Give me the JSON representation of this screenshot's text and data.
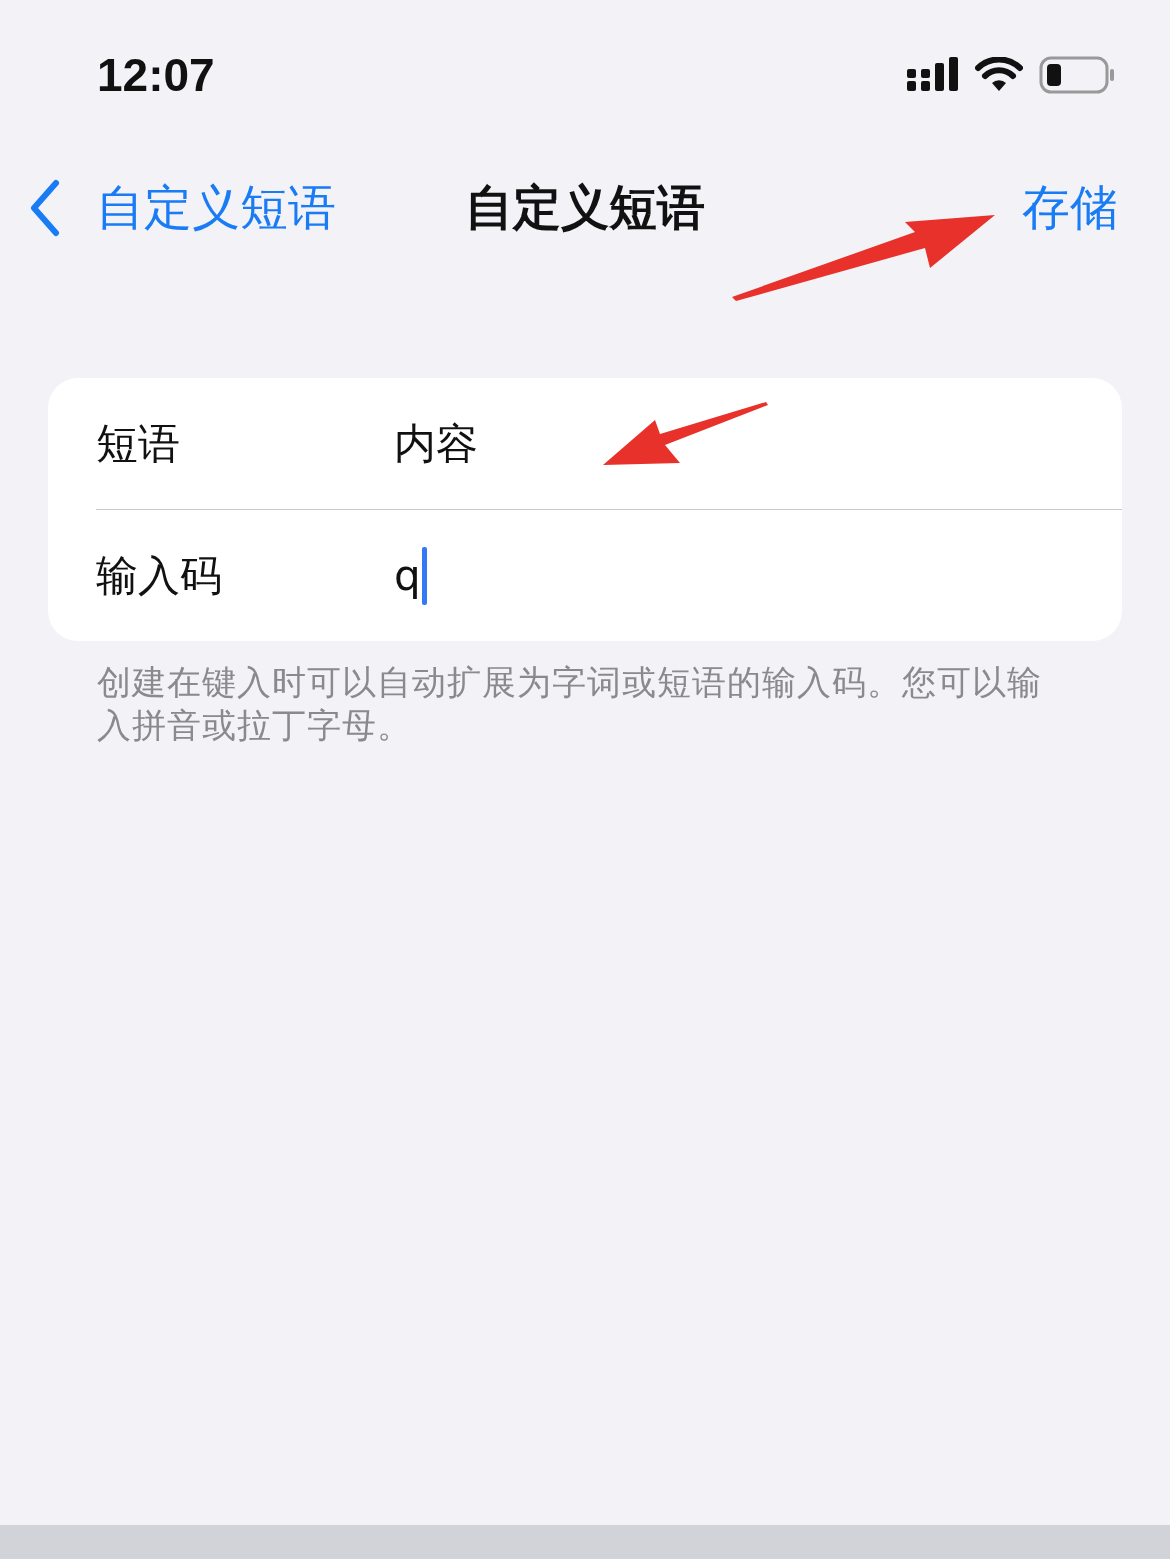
{
  "status_bar": {
    "time": "12:07"
  },
  "nav": {
    "back_label": "自定义短语",
    "title": "自定义短语",
    "save": "存储"
  },
  "rows": [
    {
      "label": "短语",
      "value": "内容",
      "focused": false
    },
    {
      "label": "输入码",
      "value": "q",
      "focused": true
    }
  ],
  "footer": "创建在键入时可以自动扩展为字词或短语的输入码。您可以输入拼音或拉丁字母。"
}
